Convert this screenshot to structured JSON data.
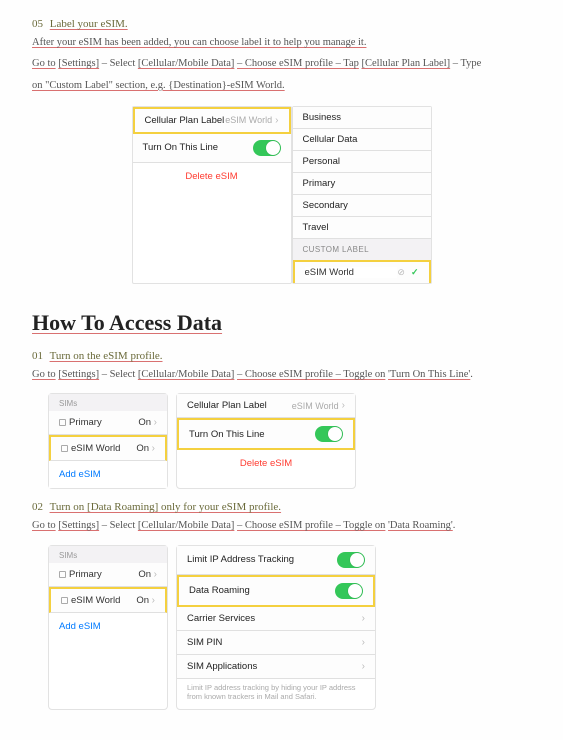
{
  "step05": {
    "num": "05",
    "title": "Label your eSIM.",
    "line1_a": "After your eSIM has been added, you can choose label it to help you manage it.",
    "line2_a": "Go to",
    "line2_b": "[Settings]",
    "line2_c": "– Select",
    "line2_d": "[Cellular/Mobile Data]",
    "line2_e": "– Choose eSIM profile – Tap",
    "line2_f": "[Cellular Plan Label]",
    "line2_g": "– Type",
    "line3_a": "on \"Custom Label\" section, e.g. {Destination}-eSIM World.",
    "left_label1": "Cellular Plan Label",
    "left_val1": "eSIM World",
    "left_label2": "Turn On This Line",
    "delete": "Delete eSIM",
    "right_items": [
      "Business",
      "Cellular Data",
      "Personal",
      "Primary",
      "Secondary",
      "Travel"
    ],
    "custom_header": "CUSTOM LABEL",
    "custom_value": "eSIM World"
  },
  "heading": "How To Access Data",
  "step01": {
    "num": "01",
    "title": "Turn on the eSIM profile.",
    "line_a": "Go to",
    "line_b": "[Settings]",
    "line_c": "– Select",
    "line_d": "[Cellular/Mobile Data]",
    "line_e": "– Choose eSIM profile – Toggle on",
    "line_f": "'Turn On This Line'",
    "sims_header": "SIMs",
    "sim1": "Primary",
    "sim1_status": "On",
    "sim2": "eSIM World",
    "sim2_status": "On",
    "add": "Add eSIM",
    "right_label1": "Cellular Plan Label",
    "right_val1": "eSIM World",
    "right_label2": "Turn On This Line",
    "delete": "Delete eSIM"
  },
  "step02": {
    "num": "02",
    "title": "Turn on [Data Roaming] only for your eSIM profile.",
    "line_a": "Go to",
    "line_b": "[Settings]",
    "line_c": "– Select",
    "line_d": "[Cellular/Mobile Data]",
    "line_e": "– Choose eSIM profile – Toggle on",
    "line_f": "'Data Roaming'",
    "sims_header": "SIMs",
    "sim1": "Primary",
    "sim1_status": "On",
    "sim2": "eSIM World",
    "sim2_status": "On",
    "add": "Add eSIM",
    "r1": "Limit IP Address Tracking",
    "r2": "Data Roaming",
    "r3": "Carrier Services",
    "r4": "SIM PIN",
    "r5": "SIM Applications",
    "hint": "Limit IP address tracking by hiding your IP address from known trackers in Mail and Safari."
  }
}
